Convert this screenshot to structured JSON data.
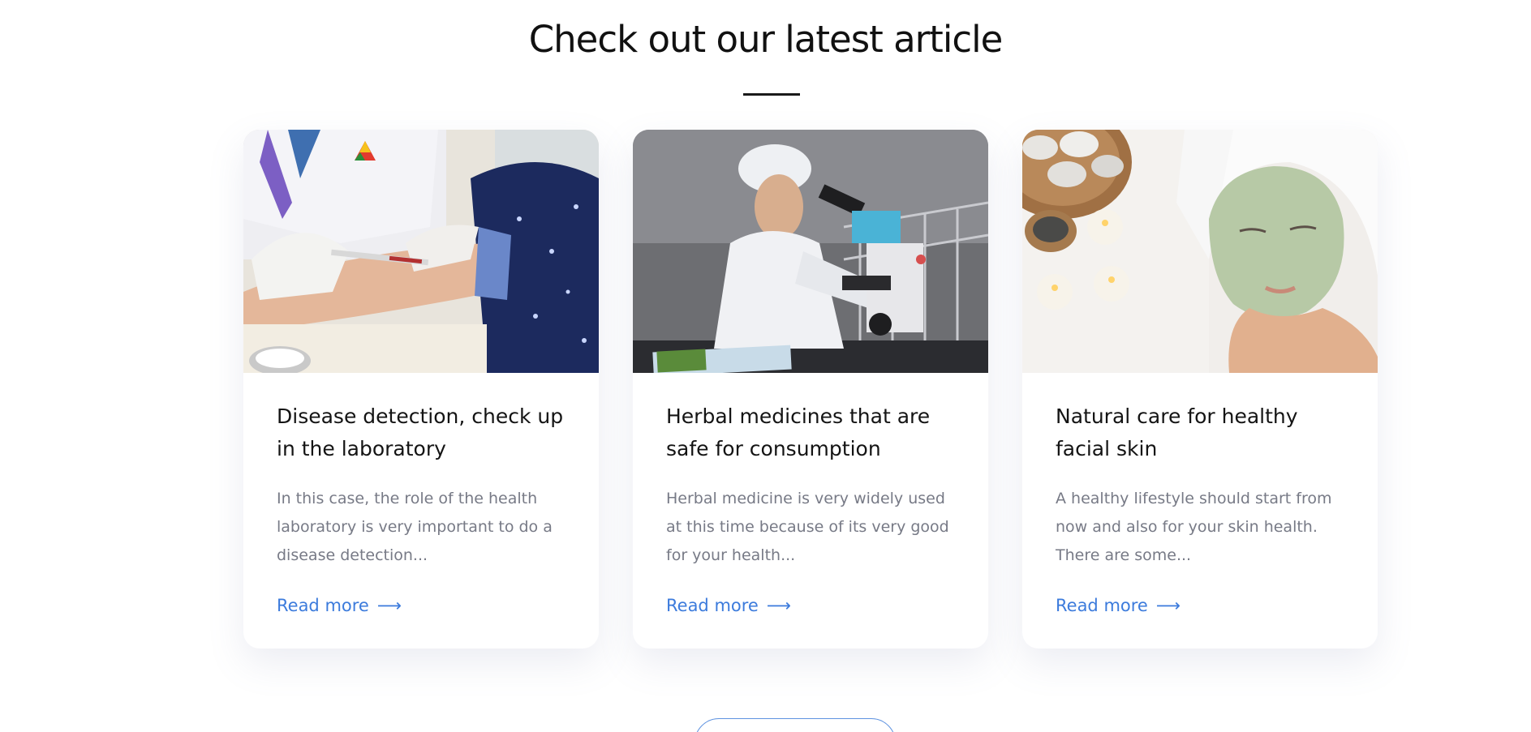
{
  "section": {
    "title": "Check out our latest article"
  },
  "articles": [
    {
      "image_subject": "blood-draw-photo",
      "title": "Disease detection, check up in the laboratory",
      "excerpt": "In this case, the role of the health laboratory is very important to do a disease detection...",
      "link_label": "Read more",
      "link_icon": "arrow-right-icon"
    },
    {
      "image_subject": "scientist-microscope-photo",
      "title": "Herbal medicines that are safe for consumption",
      "excerpt": "Herbal medicine is very widely used at this time because of its very good for your health...",
      "link_label": "Read more",
      "link_icon": "arrow-right-icon"
    },
    {
      "image_subject": "facial-mask-spa-photo",
      "title": "Natural care for healthy facial skin",
      "excerpt": "A healthy lifestyle should start from now and also for your skin health. There are some...",
      "link_label": "Read more",
      "link_icon": "arrow-right-icon"
    }
  ],
  "arrow_glyph": "⟶",
  "colors": {
    "link": "#3c7bdc",
    "heading": "#141414",
    "body_text": "#777a86",
    "button_border": "#5f93e0"
  }
}
